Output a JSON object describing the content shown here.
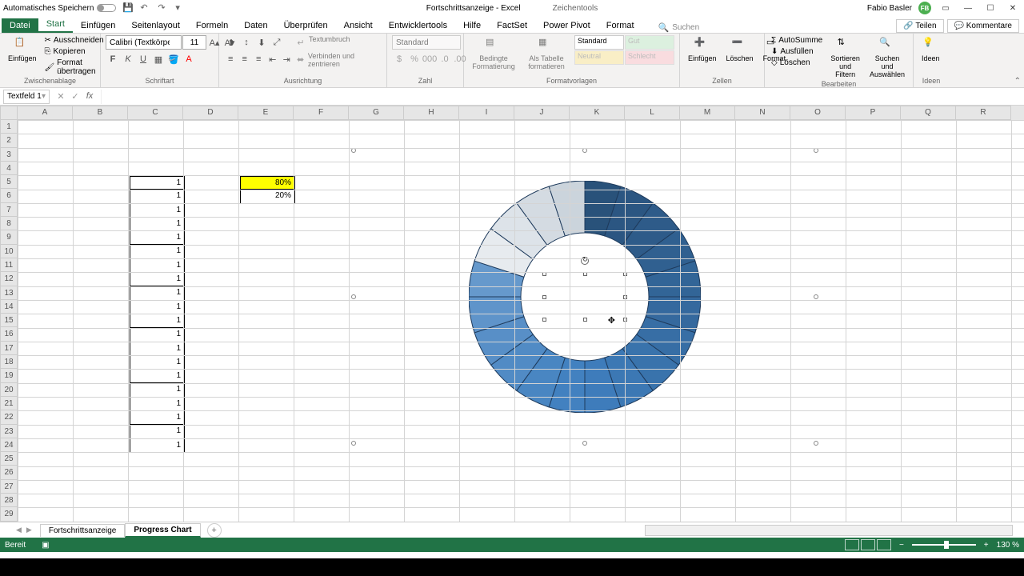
{
  "titlebar": {
    "autosave": "Automatisches Speichern",
    "filename": "Fortschrittsanzeige - Excel",
    "context_tab": "Zeichentools",
    "user": "Fabio Basler",
    "user_initials": "FB"
  },
  "tabs": {
    "datei": "Datei",
    "items": [
      "Start",
      "Einfügen",
      "Seitenlayout",
      "Formeln",
      "Daten",
      "Überprüfen",
      "Ansicht",
      "Entwicklertools",
      "Hilfe",
      "FactSet",
      "Power Pivot",
      "Format"
    ],
    "active": "Start",
    "search": "Suchen",
    "teilen": "Teilen",
    "kommentare": "Kommentare"
  },
  "ribbon": {
    "paste": "Einfügen",
    "cut": "Ausschneiden",
    "copy": "Kopieren",
    "format_painter": "Format übertragen",
    "clipboard": "Zwischenablage",
    "font_name": "Calibri (Textkörper)",
    "font_size": "11",
    "font": "Schriftart",
    "alignment": "Ausrichtung",
    "wrap": "Textumbruch",
    "merge": "Verbinden und zentrieren",
    "number_format": "Standard",
    "number": "Zahl",
    "cond_format": "Bedingte Formatierung",
    "as_table": "Als Tabelle formatieren",
    "styles": "Formatvorlagen",
    "style_standard": "Standard",
    "style_gut": "Gut",
    "style_neutral": "Neutral",
    "style_schlecht": "Schlecht",
    "insert": "Einfügen",
    "delete": "Löschen",
    "format_btn": "Format",
    "cells": "Zellen",
    "autosum": "AutoSumme",
    "fill": "Ausfüllen",
    "clear": "Löschen",
    "sort": "Sortieren und Filtern",
    "find": "Suchen und Auswählen",
    "editing": "Bearbeiten",
    "ideas": "Ideen"
  },
  "formula_bar": {
    "name_box": "Textfeld 1"
  },
  "columns": [
    "A",
    "B",
    "C",
    "D",
    "E",
    "F",
    "G",
    "H",
    "I",
    "J",
    "K",
    "L",
    "M",
    "N",
    "O",
    "P",
    "Q",
    "R"
  ],
  "rows": [
    "1",
    "2",
    "3",
    "4",
    "5",
    "6",
    "7",
    "8",
    "9",
    "10",
    "11",
    "12",
    "13",
    "14",
    "15",
    "16",
    "17",
    "18",
    "19",
    "20",
    "21",
    "22",
    "23",
    "24",
    "25",
    "26",
    "27",
    "28",
    "29"
  ],
  "data_col": [
    "1",
    "1",
    "1",
    "1",
    "1",
    "1",
    "1",
    "1",
    "1",
    "1",
    "1",
    "1",
    "1",
    "1",
    "1",
    "1",
    "1",
    "1",
    "1",
    "1"
  ],
  "pct": {
    "v1": "80%",
    "v2": "20%"
  },
  "sheets": {
    "tab1": "Fortschrittsanzeige",
    "tab2": "Progress Chart"
  },
  "status": {
    "ready": "Bereit",
    "zoom": "130 %"
  },
  "chart_data": {
    "type": "pie",
    "title": "",
    "segments": 20,
    "segment_value": 1,
    "progress_pct": 80,
    "remaining_pct": 20,
    "note": "Donut/sunburst of 20 equal slices colored as a blue gradient; inner hole blank; a text box is selected in the center."
  }
}
